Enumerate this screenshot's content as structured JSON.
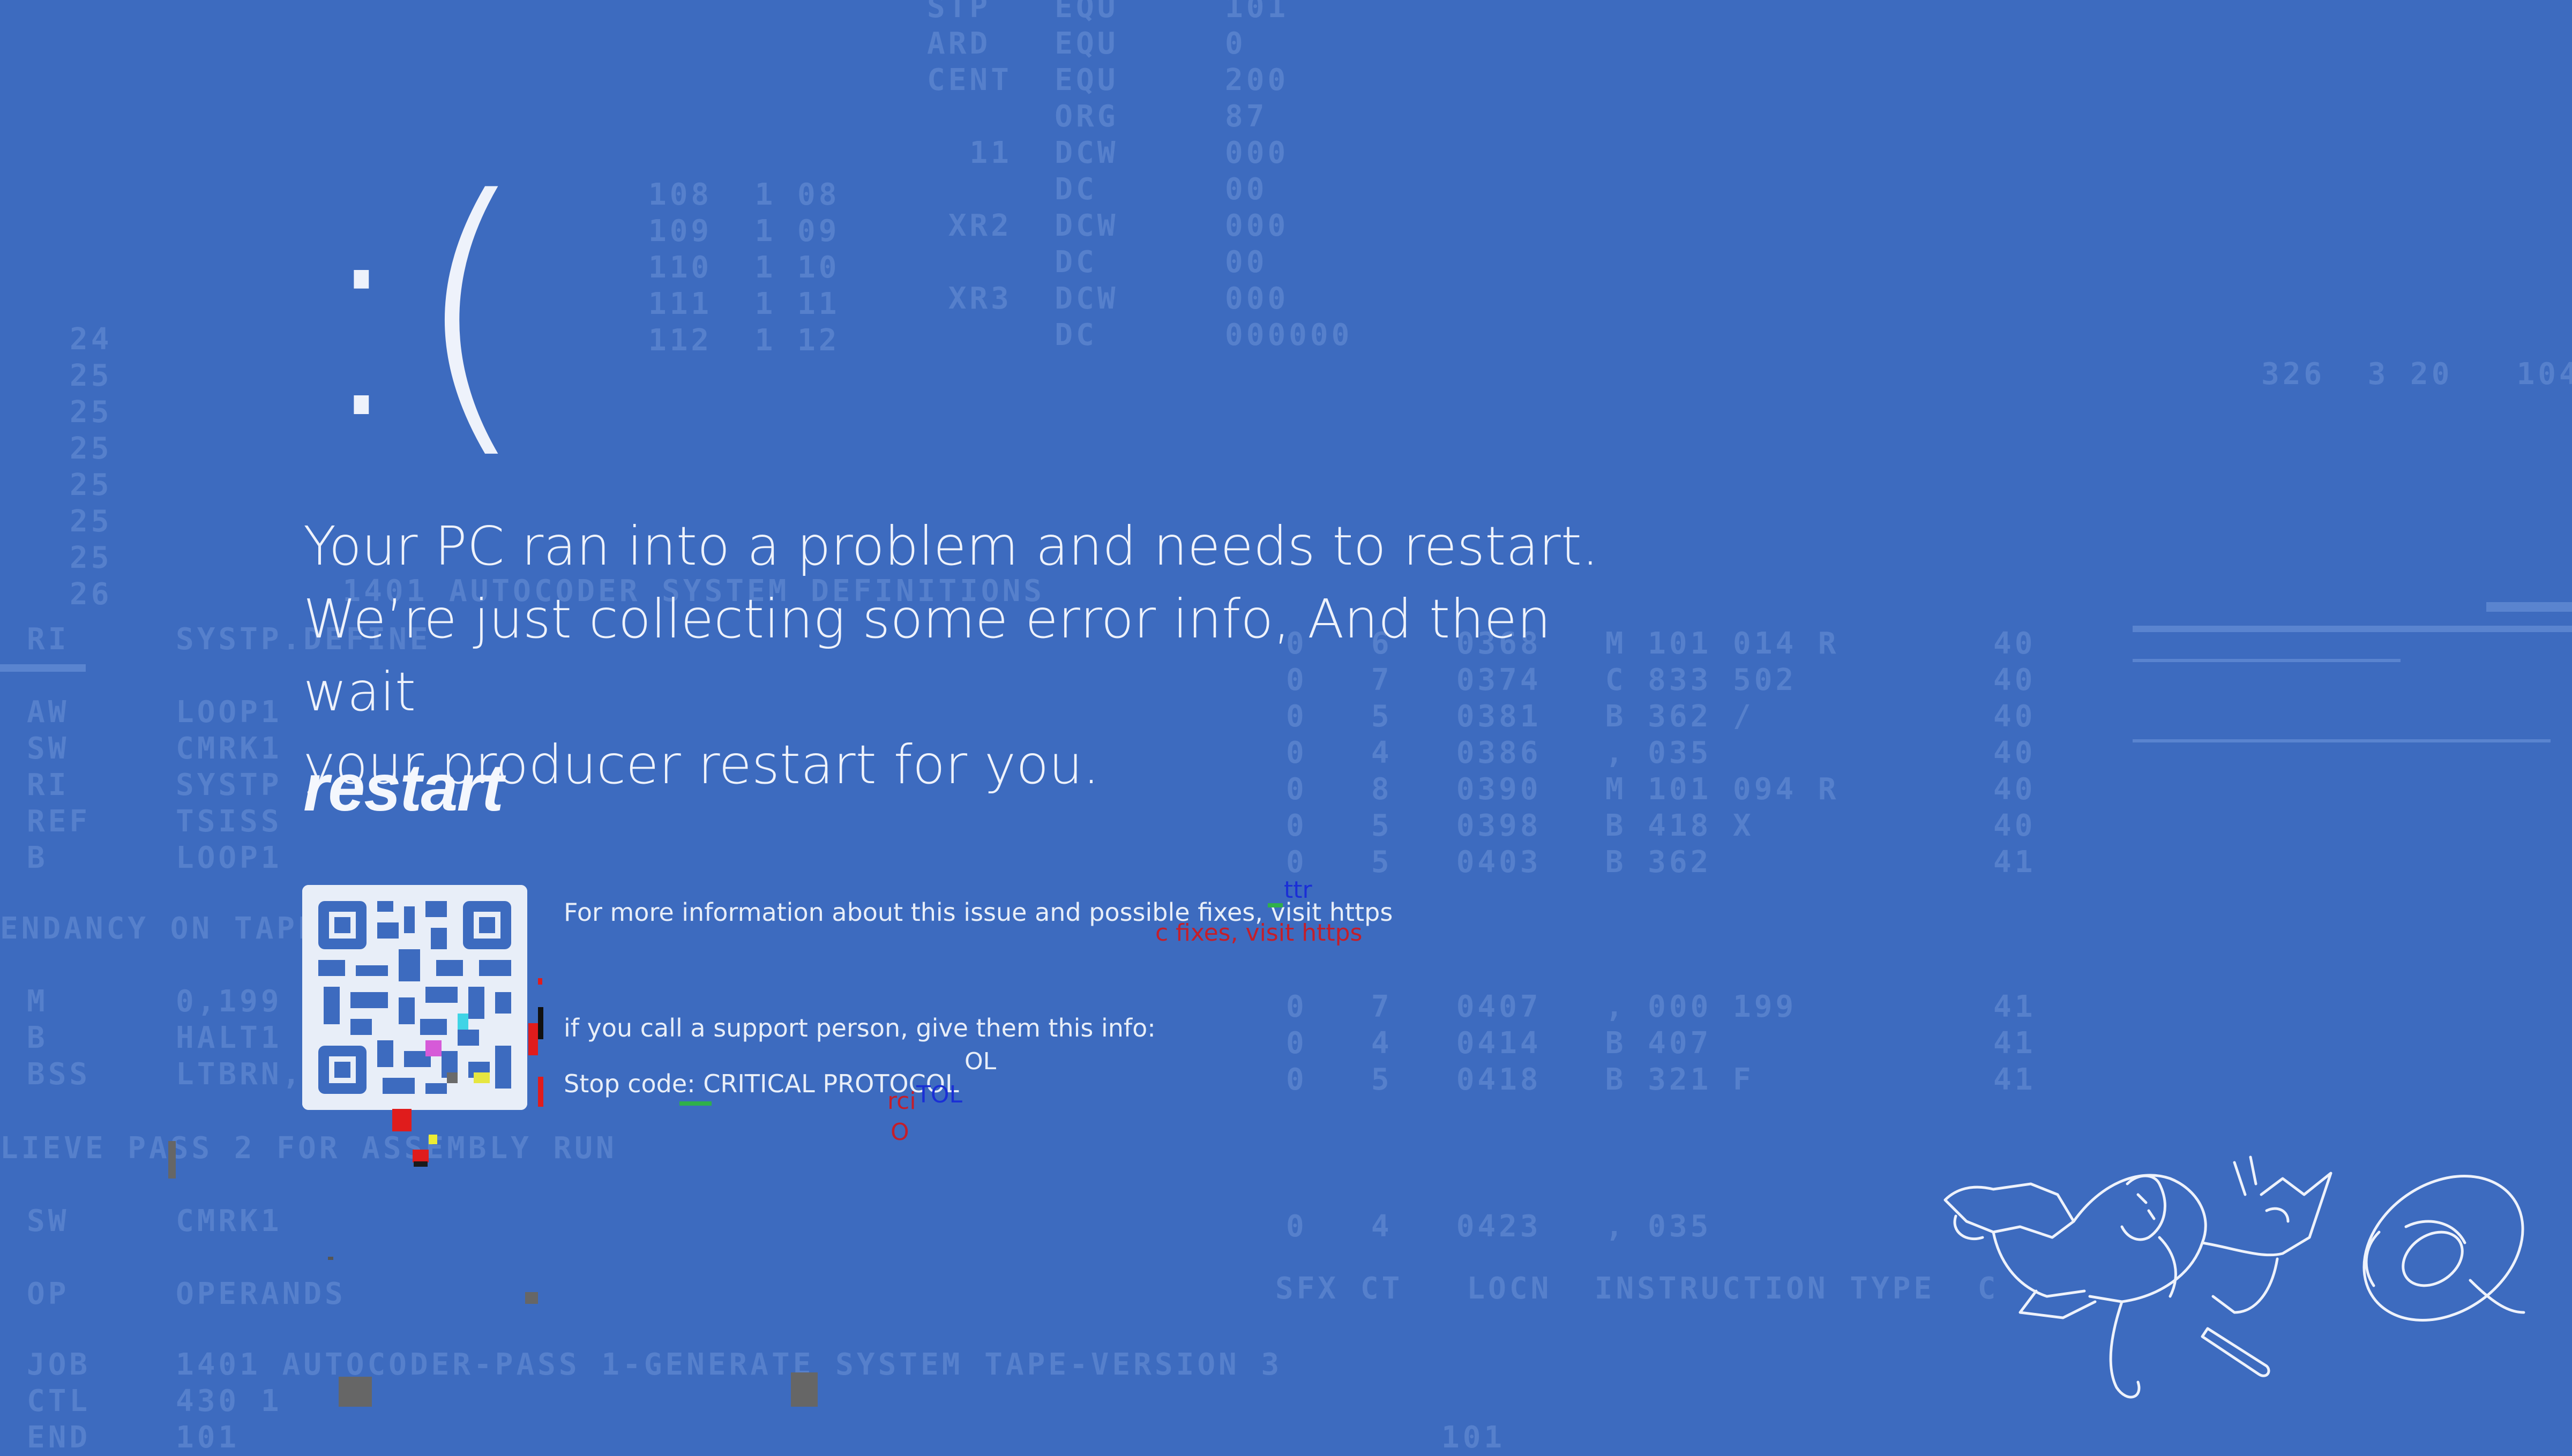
{
  "screen": {
    "face": ":(",
    "message_lines": [
      "Your PC ran into a problem and needs to restart.",
      "We’re just collecting some error info, And then wait",
      "your producer restart for you."
    ],
    "restart_label": "restart",
    "more_info": "For more information about this issue and possible fixes, visit https",
    "support_info": "if you call a support person, give them this info:",
    "stop_code": "Stop code: CRITICAL PROTOCOL"
  },
  "glitch_text": {
    "g1": "ttr",
    "g2": "c fixes, visit https",
    "g3": "OL",
    "g4": "TOL",
    "g5": "rci",
    "g6": "O"
  },
  "background_code": {
    "block_top": "STP   EQU     101\nARD   EQU     0\nCENT  EQU     200\n      ORG     87\n  11  DCW     000\n      DC      00\n XR2  DCW     000\n      DC      00\n XR3  DCW     000\n      DC      000000",
    "block_top_left": "108  1 08\n109  1 09\n110  1 10\n111  1 11\n112  1 12",
    "left_numbers": "24\n25\n25\n25\n25\n25\n25\n26",
    "left_ops": "RI     SYSTP.DEFINE\n\nAW     LOOP1\nSW     CMRK1\nRI     SYSTP\nREF    TSISS\nB      LOOP1",
    "title_line": "  1401 AUTOCODER SYSTEM DEFINITIONS",
    "dependency": "ENDANCY ON TAPE",
    "left_mid": "M      0,199\nB      HALT1\nBSS    LTBRN,B",
    "pass_line": "LIEVE PASS 2 FOR ASSEMBLY RUN",
    "left_low": "SW     CMRK1\n\nOP     OPERANDS",
    "bottom_line": "JOB    1401 AUTOCODER-PASS 1-GENERATE SYSTEM TAPE-VERSION 3",
    "bottom_rows": "CTL    430 1\nEND    101",
    "right_block": "0   6   0368   M 101 014 R\n0   7   0374   C 833 502\n0   5   0381   B 362 /\n0   4   0386   , 035\n0   8   0390   M 101 094 R\n0   5   0398   B 418 X\n0   5   0403   B 362",
    "right_cols": "40\n40\n40\n40\n40\n40\n41",
    "right_block2": "0   7   0407   , 000 199\n0   4   0414   B 407\n0   5   0418   B 321 F",
    "right_cols2": "41\n41\n41",
    "right_low": "0   4   0423   , 035",
    "header_right": "SFX CT   LOCN  INSTRUCTION TYPE  C",
    "far_right": "326  3 20   104",
    "bottom_center": "101"
  },
  "colors": {
    "background": "#3d6bbf",
    "foreground": "#eef2fb",
    "faint_code": "#5680cc"
  }
}
